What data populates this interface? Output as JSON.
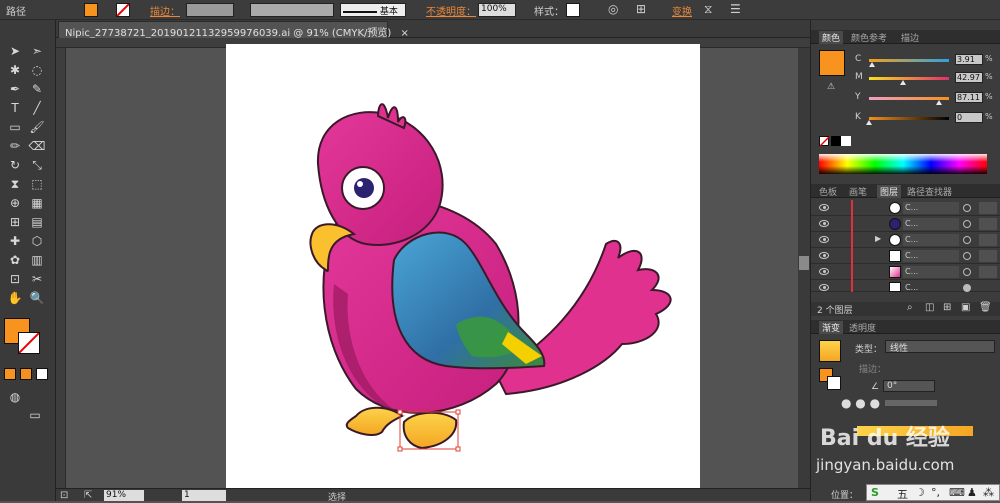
{
  "control_bar": {
    "object_type": "路径",
    "stroke_label": "描边：",
    "stroke_style": "基本",
    "opacity_label": "不透明度：",
    "opacity_value": "100%",
    "style_label": "样式：",
    "transform_label": "变换",
    "fill_color": "#f7931e"
  },
  "document": {
    "tab_title": "Nipic_27738721_20190121132959976039.ai @ 91% (CMYK/预览)",
    "close": "×"
  },
  "tools": {
    "icons": [
      "selection-icon",
      "direct-selection-icon",
      "magic-wand-icon",
      "lasso-icon",
      "pen-icon",
      "curvature-icon",
      "type-icon",
      "line-icon",
      "rectangle-icon",
      "paintbrush-icon",
      "pencil-icon",
      "eraser-icon",
      "rotate-icon",
      "scale-icon",
      "width-icon",
      "free-transform-icon",
      "shape-builder-icon",
      "perspective-icon",
      "mesh-icon",
      "gradient-icon",
      "eyedropper-icon",
      "blend-icon",
      "symbol-sprayer-icon",
      "column-graph-icon",
      "artboard-icon",
      "slice-icon",
      "hand-icon",
      "zoom-icon"
    ]
  },
  "color_panel": {
    "tabs": [
      "颜色",
      "颜色参考",
      "描边"
    ],
    "active_tab": "颜色",
    "swatch": "#f7931e",
    "channels": [
      {
        "label": "C",
        "value": "3.91",
        "pos": 0.04
      },
      {
        "label": "M",
        "value": "42.97",
        "pos": 0.43
      },
      {
        "label": "Y",
        "value": "87.11",
        "pos": 0.87
      },
      {
        "label": "K",
        "value": "0",
        "pos": 0.0
      }
    ],
    "unit": "%"
  },
  "layers_panel": {
    "tabs": [
      "色板",
      "画笔",
      "图层",
      "路径查找器"
    ],
    "active_tab": "图层",
    "rows": [
      {
        "label": "C..."
      },
      {
        "label": "C..."
      },
      {
        "label": "C..."
      },
      {
        "label": "C..."
      },
      {
        "label": "C..."
      },
      {
        "label": "C..."
      }
    ],
    "footer": "2 个图层"
  },
  "gradient_panel": {
    "tabs": [
      "渐变",
      "透明度"
    ],
    "active_tab": "渐变",
    "type_label": "类型：",
    "type_value": "线性",
    "stroke_label": "描边：",
    "angle_value": "0°",
    "location_label": "位置："
  },
  "status_bar": {
    "zoom": "91%",
    "artboard": "1",
    "tool": "选择"
  },
  "watermark": {
    "logo": "Bai du 经验",
    "url": "jingyan.baidu.com"
  },
  "ime": {
    "label": "五"
  }
}
